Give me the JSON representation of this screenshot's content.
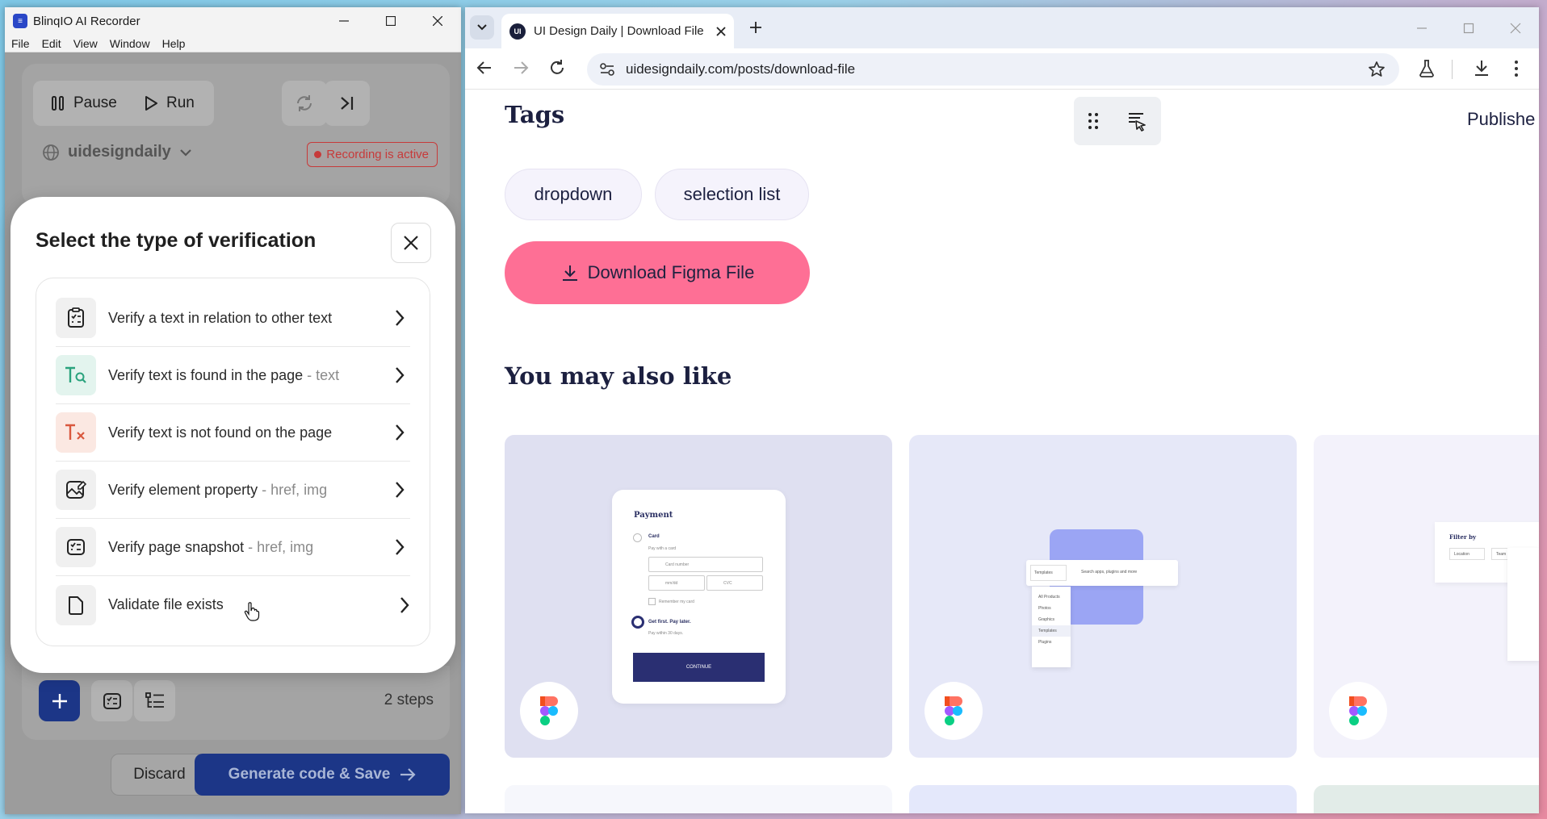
{
  "recorder": {
    "title": "BlinqIO AI Recorder",
    "menu": [
      "File",
      "Edit",
      "View",
      "Window",
      "Help"
    ],
    "pause_label": "Pause",
    "run_label": "Run",
    "site_name": "uidesigndaily",
    "recording_status": "Recording is active",
    "steps_count": "2 steps",
    "discard_label": "Discard",
    "generate_label": "Generate code & Save"
  },
  "modal": {
    "title": "Select the type of verification",
    "options": [
      {
        "label": "Verify a text in relation to other text",
        "sub": "",
        "icon": "clipboard-check-icon"
      },
      {
        "label": "Verify text is found in the page",
        "sub": " - text",
        "icon": "text-search-icon"
      },
      {
        "label": "Verify text is not found on the page",
        "sub": "",
        "icon": "text-remove-icon"
      },
      {
        "label": "Verify element property",
        "sub": " - href, img",
        "icon": "image-edit-icon"
      },
      {
        "label": "Verify page snapshot",
        "sub": " - href, img",
        "icon": "snapshot-list-icon"
      },
      {
        "label": "Validate file exists",
        "sub": "",
        "icon": "file-icon"
      }
    ]
  },
  "browser": {
    "tab_title": "UI Design Daily | Download File",
    "favicon_text": "UI",
    "url": "uidesigndaily.com/posts/download-file"
  },
  "page": {
    "tags_heading": "Tags",
    "published_label": "Publishe",
    "tags": [
      "dropdown",
      "selection list"
    ],
    "download_label": "Download Figma File",
    "also_like_heading": "You may also like",
    "card1": {
      "heading": "Payment",
      "card_label": "Card",
      "card_sub": "Pay with a card",
      "card_number": "Card number",
      "expiry": "mm/dd",
      "cvc": "CVC",
      "remember": "Remember my card",
      "later_label": "Get first. Pay later.",
      "later_sub": "Pay within 30 days.",
      "continue": "CONTINUE"
    },
    "card2": {
      "dropdown": "Templates",
      "search_placeholder": "Search apps, plugins and more",
      "items": [
        "All Products",
        "Photos",
        "Graphics",
        "Templates",
        "Plugins"
      ]
    },
    "card3": {
      "title": "Filter by",
      "filters": [
        "Location",
        "Team"
      ]
    }
  },
  "colors": {
    "accent": "#1c3687",
    "download_button": "#fe6f95",
    "recording": "#c73a3a"
  }
}
